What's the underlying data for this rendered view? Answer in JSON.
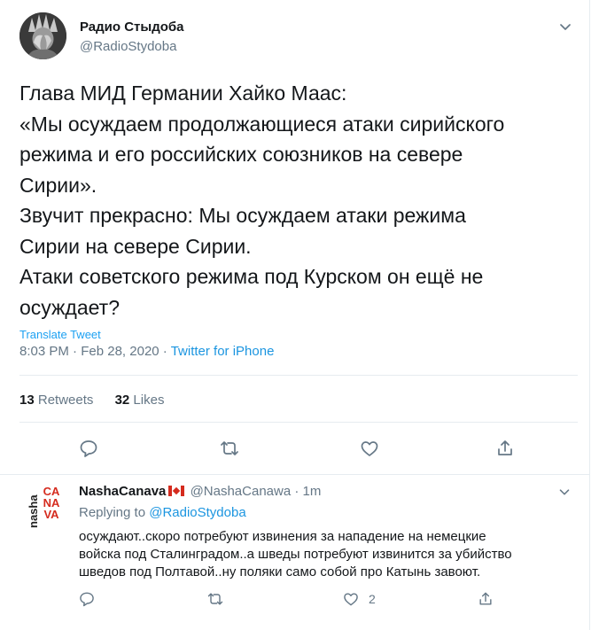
{
  "tweet": {
    "display_name": "Радио Стыдоба",
    "handle": "@RadioStydoba",
    "text_lines": [
      "Глава МИД Германии Хайко Маас:",
      "«Мы осуждаем продолжающиеся атаки сирийского",
      "режима и его российских союзников на севере",
      "Сирии».",
      "Звучит прекрасно: Мы осуждаем атаки режима",
      "Сирии на севере Сирии.",
      "Атаки советского режима под Курском он ещё не",
      "осуждает?"
    ],
    "translate_label": "Translate Tweet",
    "time": "8:03 PM",
    "separator": "·",
    "date": "Feb 28, 2020",
    "source": "Twitter for iPhone",
    "retweets_count": "13",
    "retweets_label": "Retweets",
    "likes_count": "32",
    "likes_label": "Likes"
  },
  "reply": {
    "display_name": "NashaCanava",
    "handle": "@NashaCanawa",
    "separator": "·",
    "time": "1m",
    "replying_prefix": "Replying to",
    "replying_to": "@RadioStydoba",
    "text_lines": [
      "осуждают..скоро потребуют извинения за нападение на немецкие",
      "войска под Сталинградом..а шведы потребуют извинится за убийство",
      "шведов под Полтавой..ну поляки само собой про Катынь завоют."
    ],
    "avatar_text_left": "nasha",
    "avatar_text_right": "CANAVA",
    "like_count": "2"
  },
  "icons": {
    "avatar": "statue-of-liberty-avatar",
    "caret": "chevron-down-icon",
    "reply": "comment-icon",
    "retweet": "retweet-icon",
    "like": "heart-icon",
    "share": "share-icon",
    "flag": "canada-flag-icon"
  },
  "colors": {
    "link": "#1b95e0",
    "translate": "#1da1f2",
    "secondary_text": "#657786",
    "primary_text": "#14171a",
    "divider": "#e6ecf0",
    "brand_red": "#d52b1e"
  }
}
